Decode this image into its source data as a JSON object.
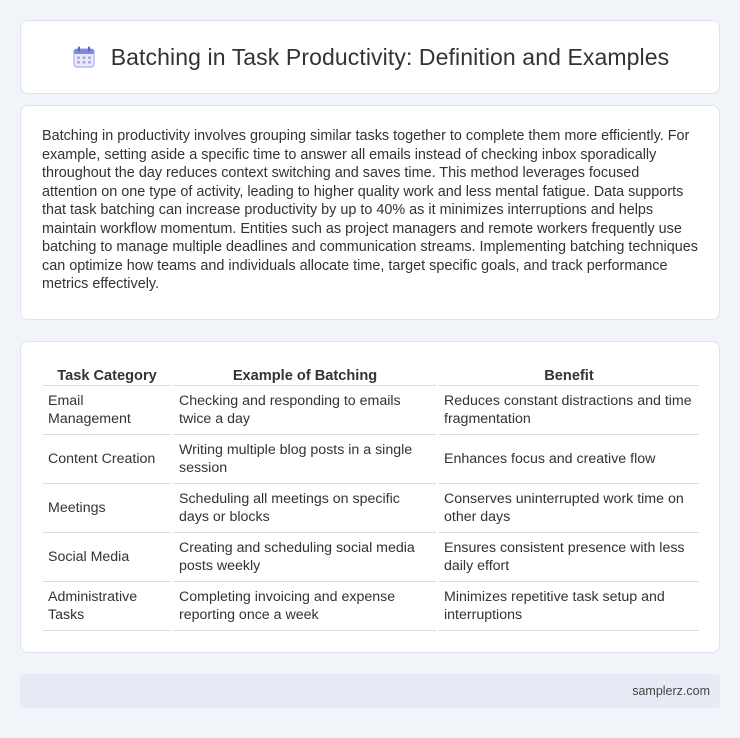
{
  "header": {
    "icon": "calendar-icon",
    "title": "Batching in Task Productivity: Definition and Examples"
  },
  "intro": {
    "text": "Batching in productivity involves grouping similar tasks together to complete them more efficiently. For example, setting aside a specific time to answer all emails instead of checking inbox sporadically throughout the day reduces context switching and saves time. This method leverages focused attention on one type of activity, leading to higher quality work and less mental fatigue. Data supports that task batching can increase productivity by up to 40% as it minimizes interruptions and helps maintain workflow momentum. Entities such as project managers and remote workers frequently use batching to manage multiple deadlines and communication streams. Implementing batching techniques can optimize how teams and individuals allocate time, target specific goals, and track performance metrics effectively."
  },
  "table": {
    "headers": [
      "Task Category",
      "Example of Batching",
      "Benefit"
    ],
    "rows": [
      [
        "Email Management",
        "Checking and responding to emails twice a day",
        "Reduces constant distractions and time fragmentation"
      ],
      [
        "Content Creation",
        "Writing multiple blog posts in a single session",
        "Enhances focus and creative flow"
      ],
      [
        "Meetings",
        "Scheduling all meetings on specific days or blocks",
        "Conserves uninterrupted work time on other days"
      ],
      [
        "Social Media",
        "Creating and scheduling social media posts weekly",
        "Ensures consistent presence with less daily effort"
      ],
      [
        "Administrative Tasks",
        "Completing invoicing and expense reporting once a week",
        "Minimizes repetitive task setup and interruptions"
      ]
    ]
  },
  "footer": {
    "site": "samplerz.com"
  },
  "colors": {
    "page_bg": "#f1f4f9",
    "card_bg": "#ffffff",
    "footer_bg": "#e6ebf5",
    "icon_accent": "#6b78d9"
  }
}
